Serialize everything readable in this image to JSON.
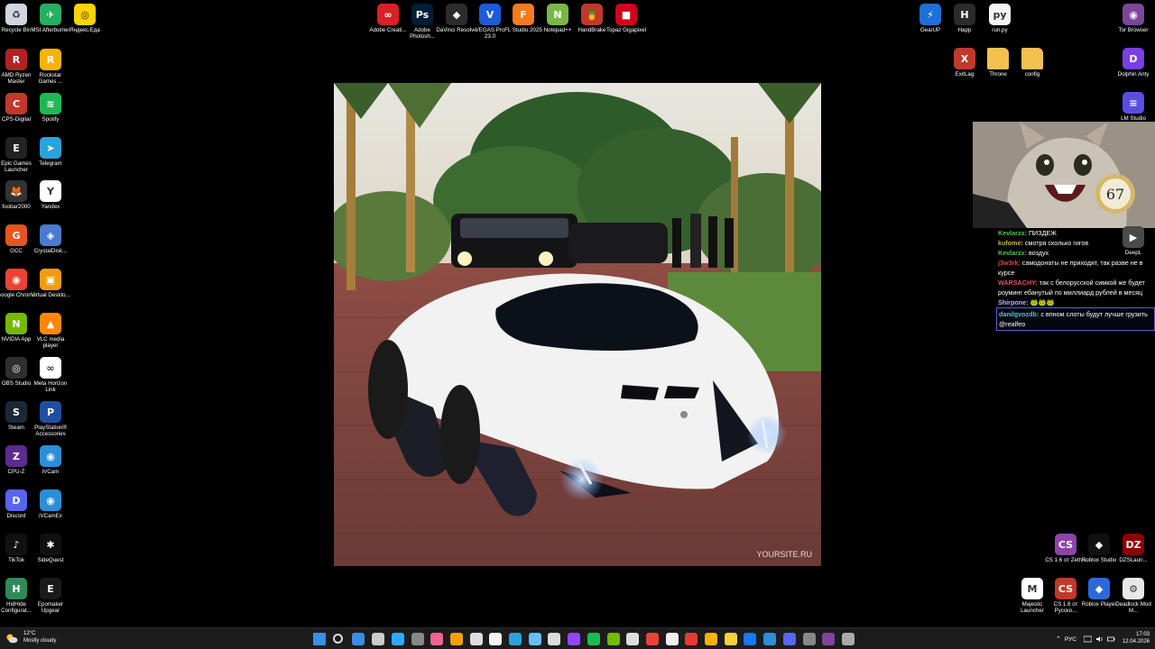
{
  "desktop": {
    "left_col1": [
      {
        "label": "Recycle Bin",
        "icon": "recycle-bin-icon",
        "color": "#cfd6de"
      },
      {
        "label": "AMD Ryzen Master",
        "icon": "amd-ryzen-icon",
        "color": "#b22222"
      },
      {
        "label": "CPS-Digital",
        "icon": "cps-digital-icon",
        "color": "#c0392b"
      },
      {
        "label": "Epic Games Launcher",
        "icon": "epic-games-icon",
        "color": "#222222"
      },
      {
        "label": "foobar2000",
        "icon": "foobar-icon",
        "color": "#333333"
      },
      {
        "label": "GCC",
        "icon": "gcc-icon",
        "color": "#e8531e"
      },
      {
        "label": "Google Chrome",
        "icon": "chrome-icon",
        "color": "#ea4335"
      },
      {
        "label": "NVIDIA App",
        "icon": "nvidia-icon",
        "color": "#76b900"
      },
      {
        "label": "OBS Studio",
        "icon": "obs-icon",
        "color": "#302e31"
      },
      {
        "label": "Steam",
        "icon": "steam-icon",
        "color": "#1b2838"
      },
      {
        "label": "CPU-Z",
        "icon": "cpu-z-icon",
        "color": "#5b2c8f"
      },
      {
        "label": "Discord",
        "icon": "discord-icon",
        "color": "#5865f2"
      },
      {
        "label": "TikTok",
        "icon": "tiktok-icon",
        "color": "#111111"
      },
      {
        "label": "HidHide Configurat...",
        "icon": "hidhide-icon",
        "color": "#2e8b57"
      }
    ],
    "left_col2": [
      {
        "label": "MSI Afterburner",
        "icon": "msi-afterburner-icon",
        "color": "#27ae60"
      },
      {
        "label": "Rockstar Games ...",
        "icon": "rockstar-icon",
        "color": "#f4b400"
      },
      {
        "label": "Spotify",
        "icon": "spotify-icon",
        "color": "#1db954"
      },
      {
        "label": "Telegram",
        "icon": "telegram-icon",
        "color": "#2aa3dc"
      },
      {
        "label": "Yandex",
        "icon": "yandex-browser-icon",
        "color": "#ffffff"
      },
      {
        "label": "CrystalDisk...",
        "icon": "crystaldisk-icon",
        "color": "#4a7bd0"
      },
      {
        "label": "Virtual Deskto...",
        "icon": "virtual-desktop-icon",
        "color": "#f39c12"
      },
      {
        "label": "VLC media player",
        "icon": "vlc-icon",
        "color": "#ff8800"
      },
      {
        "label": "Meta Horizon Link",
        "icon": "meta-icon",
        "color": "#ffffff"
      },
      {
        "label": "PlayStation® Accessories",
        "icon": "playstation-icon",
        "color": "#1f4fa0"
      },
      {
        "label": "iVCam",
        "icon": "ivcam-icon",
        "color": "#2a8fd8"
      },
      {
        "label": "iVCamEx",
        "icon": "ivcamex-icon",
        "color": "#2a8fd8"
      },
      {
        "label": "SideQuest",
        "icon": "sidequest-icon",
        "color": "#111111"
      },
      {
        "label": "Epomaker Upgear",
        "icon": "epomaker-icon",
        "color": "#1a1a1a"
      }
    ],
    "yandex_eda": {
      "label": "Яндекс.Еда",
      "icon": "yandex-eda-icon",
      "color": "#ffd200"
    },
    "top_center": [
      {
        "label": "Adobe Creati...",
        "icon": "adobe-cc-icon",
        "color": "#da1f26"
      },
      {
        "label": "Adobe Photosh...",
        "icon": "photoshop-icon",
        "color": "#001e36"
      },
      {
        "label": "DaVinci Resolve",
        "icon": "davinci-icon",
        "color": "#2c2c2c"
      },
      {
        "label": "VEGAS Pro 23.0",
        "icon": "vegas-icon",
        "color": "#1e5bd8"
      },
      {
        "label": "FL Studio 2025",
        "icon": "fl-studio-icon",
        "color": "#f47b20"
      },
      {
        "label": "Notepad++",
        "icon": "notepadpp-icon",
        "color": "#7ab648"
      },
      {
        "label": "HandBrake",
        "icon": "handbrake-icon",
        "color": "#c0392b"
      },
      {
        "label": "Topaz Gigapixel",
        "icon": "topaz-icon",
        "color": "#d0021b"
      }
    ],
    "top_right": [
      {
        "label": "GearUP",
        "icon": "gearup-icon",
        "color": "#1e6fd8"
      },
      {
        "label": "Happ",
        "icon": "happ-icon",
        "color": "#2b2b2b"
      },
      {
        "label": "run.py",
        "icon": "python-file-icon",
        "color": "#f5f5f5"
      },
      {
        "label": "Tor Browser",
        "icon": "tor-browser-icon",
        "color": "#7d4698"
      },
      {
        "label": "ExitLag",
        "icon": "exitlag-icon",
        "color": "#c0392b"
      },
      {
        "label": "Throne",
        "icon": "folder-icon",
        "color": "#f2c14e"
      },
      {
        "label": "config",
        "icon": "folder-icon",
        "color": "#f2c14e"
      },
      {
        "label": "Dolphin Anty",
        "icon": "dolphin-anty-icon",
        "color": "#7b3fe4"
      },
      {
        "label": "LM Studio",
        "icon": "lm-studio-icon",
        "color": "#5a4ee0"
      }
    ],
    "bottom_right": [
      {
        "label": "CS 1.6 от Zethis",
        "icon": "cs16-icon",
        "color": "#8e44ad"
      },
      {
        "label": "Roblox Studio",
        "icon": "roblox-studio-icon",
        "color": "#111111"
      },
      {
        "label": "DZSLaun...",
        "icon": "dzs-launcher-icon",
        "color": "#8b0000"
      },
      {
        "label": "Majestic Launcher",
        "icon": "majestic-icon",
        "color": "#ffffff"
      },
      {
        "label": "CS 1.6 от Русско...",
        "icon": "cs16-ru-icon",
        "color": "#c0392b"
      },
      {
        "label": "Roblox Player",
        "icon": "roblox-player-icon",
        "color": "#2a6ad8"
      },
      {
        "label": "Deadlock Mod M...",
        "icon": "deadlock-icon",
        "color": "#e8e8e8"
      }
    ],
    "deepl": {
      "label": "DeepL",
      "icon": "deepl-icon",
      "color": "#4a4a4a"
    }
  },
  "wallpaper": {
    "watermark": "YOURSITE.RU"
  },
  "chat": {
    "messages": [
      {
        "user": "Kevlarzx:",
        "user_color": "#4ac94a",
        "text": " ПИЗДЕЖ"
      },
      {
        "user": "kufome:",
        "user_color": "#c9b24a",
        "text": " смотря сколько гигов"
      },
      {
        "user": "Kevlarzx:",
        "user_color": "#4ac94a",
        "text": " воздух"
      },
      {
        "user": "j3w3rk:",
        "user_color": "#d84a4a",
        "text": " самодонаты не приходят, так разве не в курсе"
      },
      {
        "user": "WARSACHY:",
        "user_color": "#e0506a",
        "text": " так с белорусской симкой же будет роуминг ебанутый по миллиард рублей в месяц"
      },
      {
        "user": "Shirpone:",
        "user_color": "#b9b9ff",
        "text": " 🐸🐸🐸"
      },
      {
        "user": "danilgvozdb:",
        "user_color": "#4ac9c9",
        "text": " с впном слоты будут лучше грузить @realfeo"
      }
    ]
  },
  "taskbar": {
    "weather_temp": "12°C",
    "weather_desc": "Mostly cloudy",
    "lang": "РУС",
    "time": "17:03",
    "date": "12.04.2026",
    "pinned": [
      {
        "icon": "start-icon",
        "color": "#3a8ee6"
      },
      {
        "icon": "search-icon",
        "color": "#dddddd"
      },
      {
        "icon": "file-explorer-icon",
        "color": "#3a8ee6"
      },
      {
        "icon": "obs-icon",
        "color": "#cccccc"
      },
      {
        "icon": "photoshop-icon",
        "color": "#31a8ff"
      },
      {
        "icon": "davinci-icon",
        "color": "#888888"
      },
      {
        "icon": "itunes-icon",
        "color": "#f06292"
      },
      {
        "icon": "audacity-icon",
        "color": "#f4a000"
      },
      {
        "icon": "media-icon",
        "color": "#dddddd"
      },
      {
        "icon": "notepad-icon",
        "color": "#f5f5f5"
      },
      {
        "icon": "telegram-icon",
        "color": "#2aa3dc"
      },
      {
        "icon": "steam-icon",
        "color": "#66c0f4"
      },
      {
        "icon": "chatgpt-icon",
        "color": "#dddddd"
      },
      {
        "icon": "twitch-icon",
        "color": "#9146ff"
      },
      {
        "icon": "spotify-icon",
        "color": "#1db954"
      },
      {
        "icon": "nvidia-icon",
        "color": "#76b900"
      },
      {
        "icon": "clock-icon",
        "color": "#dddddd"
      },
      {
        "icon": "chrome-icon",
        "color": "#ea4335"
      },
      {
        "icon": "vpn-icon",
        "color": "#eeeeee"
      },
      {
        "icon": "music-icon",
        "color": "#e53935"
      },
      {
        "icon": "shield-icon",
        "color": "#f4b400"
      },
      {
        "icon": "browser-icon",
        "color": "#f4d03f"
      },
      {
        "icon": "meta-icon",
        "color": "#1877f2"
      },
      {
        "icon": "globe-icon",
        "color": "#2a8fd8"
      },
      {
        "icon": "discord-icon",
        "color": "#5865f2"
      },
      {
        "icon": "text-icon",
        "color": "#888888"
      },
      {
        "icon": "tor-icon",
        "color": "#7d4698"
      },
      {
        "icon": "settings-icon",
        "color": "#aaaaaa"
      }
    ]
  }
}
